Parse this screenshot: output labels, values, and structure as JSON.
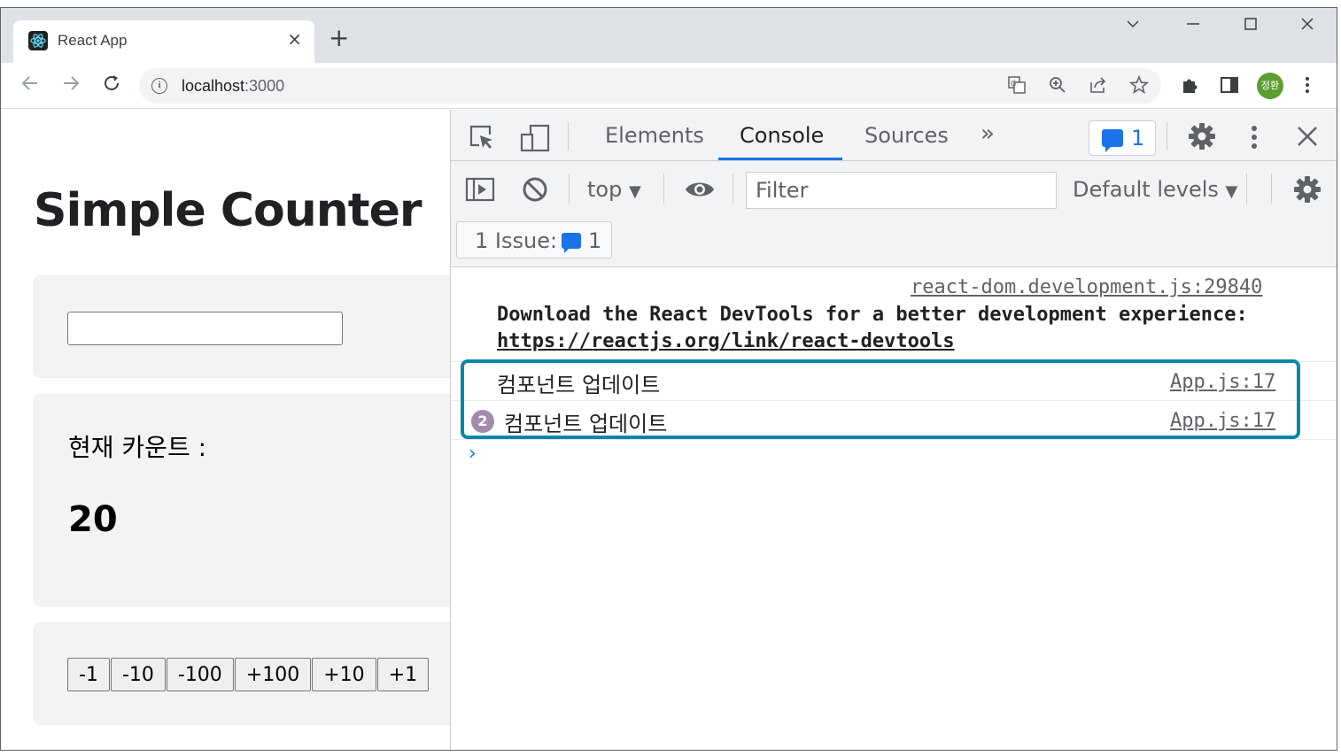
{
  "browser": {
    "tab_title": "React App",
    "tab_close": "×",
    "new_tab": "+",
    "window_controls": {
      "dropdown": "⌵",
      "minimize": "—",
      "maximize": "☐",
      "close": "✕"
    },
    "url_host": "localhost",
    "url_port": ":3000",
    "profile_label": "정환"
  },
  "page": {
    "title": "Simple Counter",
    "input_value": "",
    "count_label": "현재 카운트 :",
    "count_value": "20",
    "buttons": [
      "-1",
      "-10",
      "-100",
      "+100",
      "+10",
      "+1"
    ]
  },
  "devtools": {
    "tabs": [
      "Elements",
      "Console",
      "Sources"
    ],
    "more_tabs": "»",
    "issues_count": "1",
    "context": "top",
    "filter_placeholder": "Filter",
    "levels": "Default levels",
    "issue_label": "1 Issue:",
    "issue_count": "1",
    "console": {
      "source1": "react-dom.development.js:29840",
      "message_line1": "Download the React DevTools for a better development experience:",
      "message_link": "https://reactjs.org/link/react-devtools",
      "log1_text": "컴포넌트 업데이트",
      "log1_source": "App.js:17",
      "log2_count": "2",
      "log2_text": "컴포넌트 업데이트",
      "log2_source": "App.js:17",
      "prompt": "›"
    }
  }
}
